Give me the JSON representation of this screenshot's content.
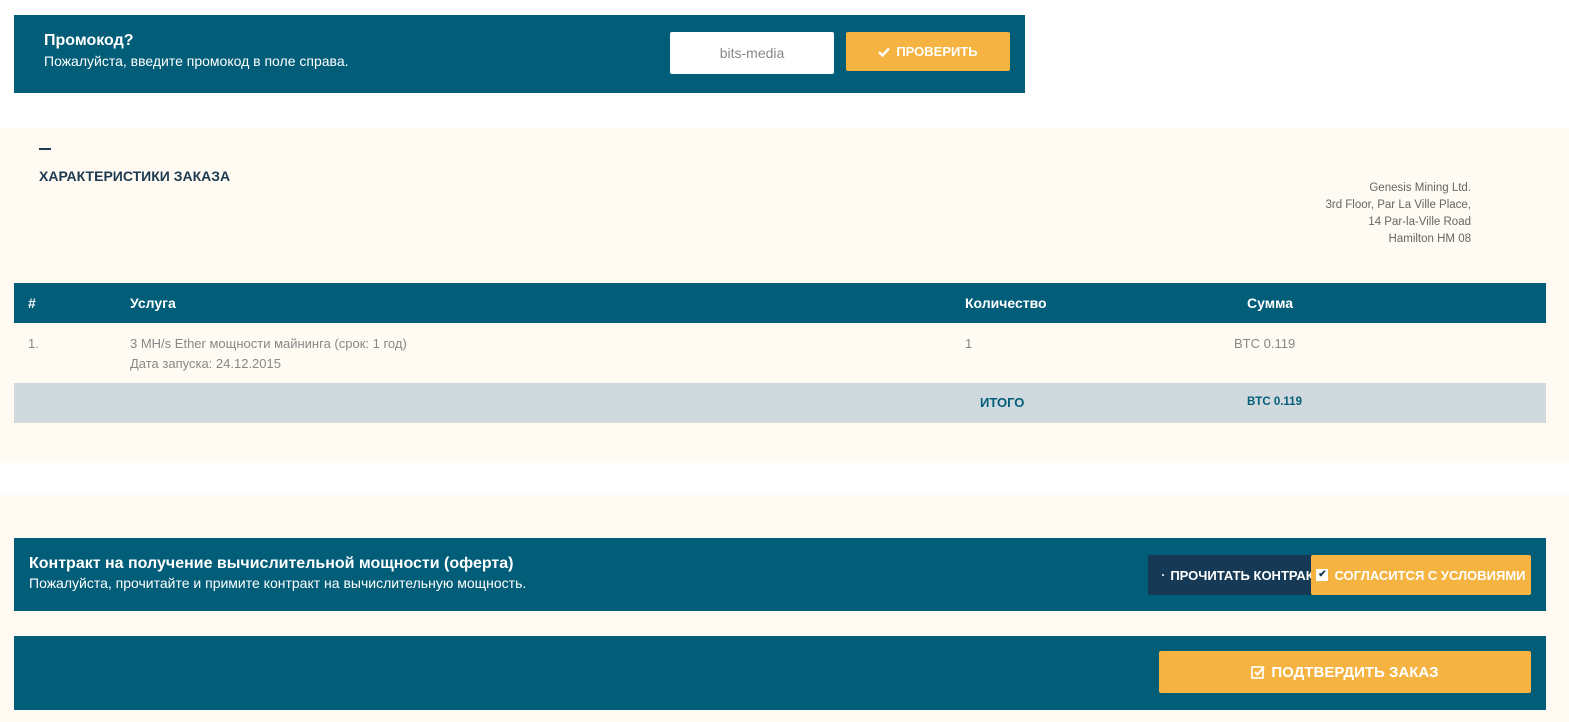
{
  "promo": {
    "title": "Промокод?",
    "subtitle": "Пожалуйста, введите промокод в поле справа.",
    "input_value": "bits-media",
    "check_label": "ПРОВЕРИТЬ"
  },
  "order": {
    "heading": "ХАРАКТЕРИСТИКИ ЗАКАЗА",
    "address": [
      "Genesis Mining Ltd.",
      "3rd Floor, Par La Ville Place,",
      "14 Par-la-Ville Road",
      "Hamilton HM 08"
    ],
    "columns": [
      "#",
      "Услуга",
      "Количество",
      "Сумма"
    ],
    "rows": [
      {
        "num": "1.",
        "service": "3  MH/s Ether мощности майнинга (срок: 1 год)",
        "start_date": "Дата запуска: 24.12.2015",
        "quantity": "1",
        "sum": "BTC 0.119"
      }
    ],
    "total_label": "ИТОГО",
    "total_value": "BTC 0.119"
  },
  "contract": {
    "title": "Контракт на получение вычислительной мощности (оферта)",
    "subtitle": "Пожалуйста, прочитайте и примите контракт на вычислительную мощность.",
    "read_label": "ПРОЧИТАТЬ КОНТРАКТ",
    "agree_label": "СОГЛАСИТСЯ С УСЛОВИЯМИ"
  },
  "confirm": {
    "label": "ПОДТВЕРДИТЬ ЗАКАЗ"
  },
  "colors": {
    "primary": "#025d78",
    "accent": "#f5b342",
    "dark": "#163a55",
    "total_row": "#cfd9de",
    "section_bg": "#fffaf2"
  }
}
